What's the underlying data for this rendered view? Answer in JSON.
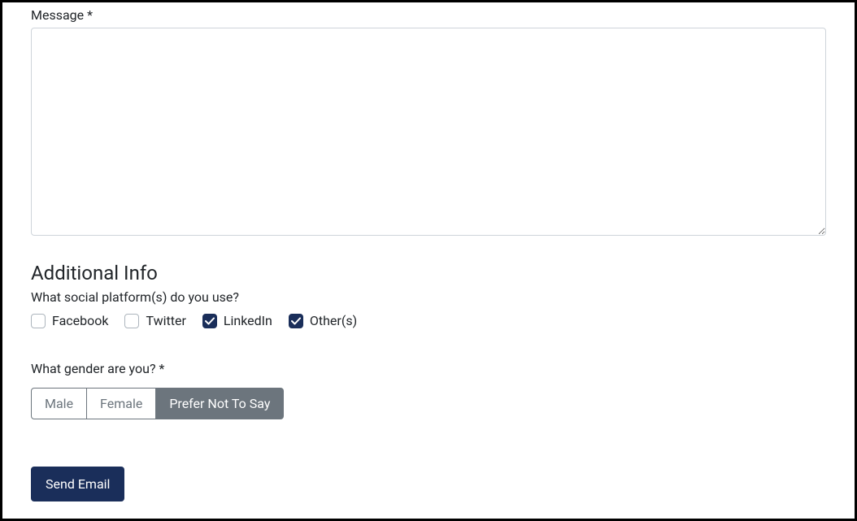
{
  "message": {
    "label": "Message *",
    "value": ""
  },
  "additional_info": {
    "heading": "Additional Info",
    "social_question": "What social platform(s) do you use?",
    "social_options": [
      {
        "label": "Facebook",
        "checked": false
      },
      {
        "label": "Twitter",
        "checked": false
      },
      {
        "label": "LinkedIn",
        "checked": true
      },
      {
        "label": "Other(s)",
        "checked": true
      }
    ],
    "gender_question": "What gender are you? *",
    "gender_options": [
      {
        "label": "Male",
        "active": false
      },
      {
        "label": "Female",
        "active": false
      },
      {
        "label": "Prefer Not To Say",
        "active": true
      }
    ]
  },
  "submit": {
    "label": "Send Email"
  }
}
